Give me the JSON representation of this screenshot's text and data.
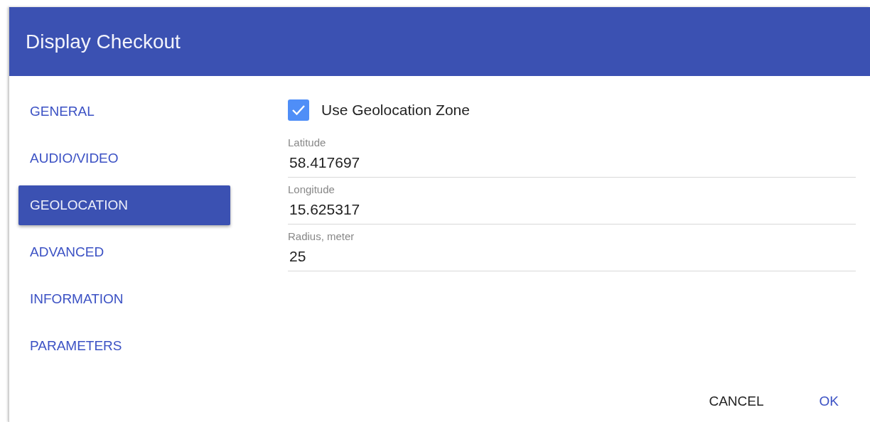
{
  "window": {
    "title": "Display Checkout"
  },
  "sidebar": {
    "items": [
      {
        "label": "GENERAL",
        "selected": false
      },
      {
        "label": "AUDIO/VIDEO",
        "selected": false
      },
      {
        "label": "GEOLOCATION",
        "selected": true
      },
      {
        "label": "ADVANCED",
        "selected": false
      },
      {
        "label": "INFORMATION",
        "selected": false
      },
      {
        "label": "PARAMETERS",
        "selected": false
      }
    ]
  },
  "geolocation": {
    "checkbox": {
      "label": "Use Geolocation Zone",
      "checked": true
    },
    "fields": [
      {
        "label": "Latitude",
        "value": "58.417697"
      },
      {
        "label": "Longitude",
        "value": "15.625317"
      },
      {
        "label": "Radius, meter",
        "value": "25"
      }
    ]
  },
  "buttons": [
    {
      "label": "CANCEL",
      "kind": "secondary"
    },
    {
      "label": "OK",
      "kind": "primary"
    }
  ]
}
